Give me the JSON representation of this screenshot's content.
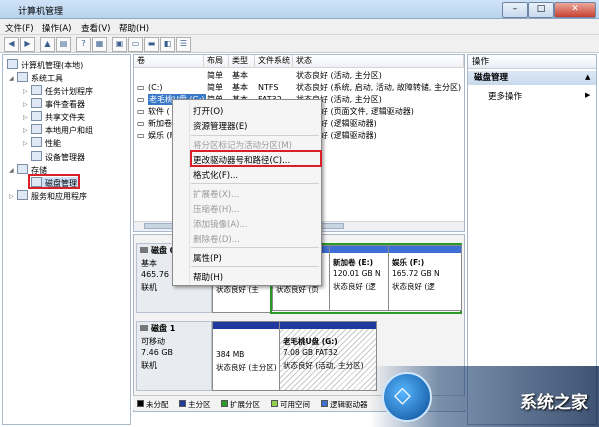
{
  "window": {
    "title": "计算机管理",
    "min": "–",
    "max": "□",
    "close": "✕"
  },
  "menubar": [
    "文件(F)",
    "操作(A)",
    "查看(V)",
    "帮助(H)"
  ],
  "tree": {
    "root": "计算机管理(本地)",
    "system_tools": "系统工具",
    "task_scheduler": "任务计划程序",
    "event_viewer": "事件查看器",
    "shared_folders": "共享文件夹",
    "local_users": "本地用户和组",
    "performance": "性能",
    "device_manager": "设备管理器",
    "storage": "存储",
    "disk_management": "磁盘管理",
    "services": "服务和应用程序"
  },
  "volume_list": {
    "headers": [
      "卷",
      "布局",
      "类型",
      "文件系统",
      "状态"
    ],
    "rows": [
      {
        "vol": "",
        "layout": "简单",
        "type": "基本",
        "fs": "",
        "status": "状态良好 (活动, 主分区)"
      },
      {
        "vol": "(C:)",
        "layout": "简单",
        "type": "基本",
        "fs": "NTFS",
        "status": "状态良好 (系统, 启动, 活动, 故障转储, 主分区)"
      },
      {
        "vol": "老毛桃U盘 (G:)",
        "layout": "简单",
        "type": "基本",
        "fs": "FAT32",
        "status": "状态良好 (活动, 主分区)"
      },
      {
        "vol": "软件 (",
        "layout": "",
        "type": "",
        "fs": "",
        "status": "状态良好 (页面文件, 逻辑驱动器)"
      },
      {
        "vol": "新加卷",
        "layout": "",
        "type": "",
        "fs": "",
        "status": "状态良好 (逻辑驱动器)"
      },
      {
        "vol": "娱乐 (F",
        "layout": "",
        "type": "",
        "fs": "",
        "status": "状态良好 (逻辑驱动器)"
      }
    ]
  },
  "disk0": {
    "label": "磁盘 0",
    "kind": "基本",
    "size": "465.76 GB",
    "state": "联机",
    "parts": [
      {
        "status": "状态良好 (主"
      },
      {
        "status": "状态良好 (页"
      },
      {
        "title": "新加卷 (E:)",
        "size": "120.01 GB N",
        "status": "状态良好 (逻"
      },
      {
        "title": "娱乐 (F:)",
        "size": "165.72 GB N",
        "status": "状态良好 (逻"
      }
    ]
  },
  "disk1": {
    "label": "磁盘 1",
    "kind": "可移动",
    "size": "7.46 GB",
    "state": "联机",
    "parts": [
      {
        "size": "384 MB",
        "status": "状态良好 (主分区)"
      },
      {
        "title": "老毛桃U盘 (G:)",
        "size": "7.08 GB FAT32",
        "status": "状态良好 (活动, 主分区)"
      }
    ]
  },
  "legend": [
    {
      "label": "未分配",
      "color": "#000000"
    },
    {
      "label": "主分区",
      "color": "#1f3a9c"
    },
    {
      "label": "扩展分区",
      "color": "#2a9a2a"
    },
    {
      "label": "可用空间",
      "color": "#8fd14f"
    },
    {
      "label": "逻辑驱动器",
      "color": "#3d6fd6"
    }
  ],
  "actions": {
    "header": "操作",
    "section": "磁盘管理",
    "more": "更多操作"
  },
  "context_menu": {
    "open": "打开(O)",
    "explore": "资源管理器(E)",
    "mark_active": "将分区标记为活动分区(M)",
    "change_letter": "更改驱动器号和路径(C)...",
    "format": "格式化(F)...",
    "extend": "扩展卷(X)...",
    "shrink": "压缩卷(H)...",
    "add_mirror": "添加镜像(A)...",
    "delete": "删除卷(D)...",
    "properties": "属性(P)",
    "help": "帮助(H)"
  },
  "watermark": {
    "text": "系统之家"
  }
}
